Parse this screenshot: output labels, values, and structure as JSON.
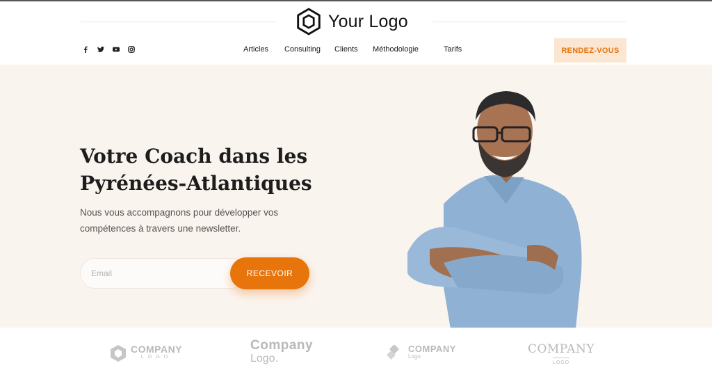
{
  "header": {
    "logo_text": "Your Logo",
    "logo_icon": "hexagon-logo-icon",
    "social": [
      "facebook-icon",
      "twitter-icon",
      "youtube-icon",
      "instagram-icon"
    ],
    "nav": [
      "Articles",
      "Consulting",
      "Clients",
      "Méthodologie",
      "Tarifs"
    ],
    "cta": "RENDEZ-VOUS"
  },
  "hero": {
    "title_line1": "Votre Coach dans les",
    "title_line2": "Pyrénées-Atlantiques",
    "subtitle": "Nous vous accompagnons pour développer vos compétences à travers une newsletter.",
    "email_placeholder": "Email",
    "submit": "RECEVOIR"
  },
  "logos": [
    {
      "line1": "COMPANY",
      "line2": "LOGO"
    },
    {
      "line1": "Company",
      "line2": "Logo."
    },
    {
      "line1": "COMPANY",
      "line2": "Logo"
    },
    {
      "line1": "COMPANY",
      "line2": "LOGO"
    }
  ],
  "colors": {
    "accent": "#e8740c",
    "cta_bg": "#fbe6d3",
    "hero_bg": "#faf4ef"
  }
}
